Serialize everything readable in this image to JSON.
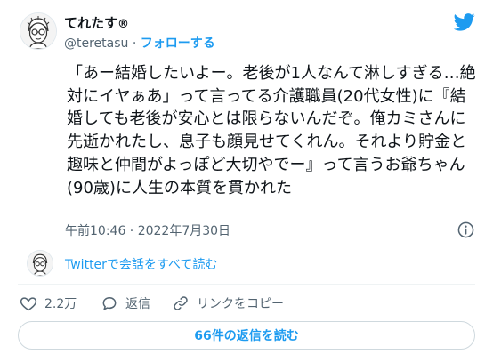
{
  "author": {
    "name": "てれたす",
    "badge": "®",
    "handle": "@teretasu",
    "separator": "·",
    "follow_label": "フォローする"
  },
  "tweet": {
    "text": "「あー結婚したいよー。老後が1人なんて淋しすぎる…絶対にイヤぁあ」って言ってる介護職員(20代女性)に『結婚しても老後が安心とは限らないんだぞ。俺カミさんに先逝かれたし、息子も顔見せてくれん。それより貯金と趣味と仲間がよっぽど大切やでー』って言うお爺ちゃん(90歳)に人生の本質を貫かれた",
    "time": "午前10:46 · 2022年7月30日"
  },
  "conversation": {
    "link_label": "Twitterで会話をすべて読む"
  },
  "actions": {
    "likes_count": "2.2万",
    "reply_label": "返信",
    "copy_link_label": "リンクをコピー"
  },
  "footer": {
    "replies_button": "66件の返信を読む"
  },
  "colors": {
    "accent": "#1d9bf0",
    "text": "#0f1419",
    "muted": "#536471",
    "like_icon": "#f91880"
  },
  "icons": {
    "brand": "twitter-bird-icon",
    "info": "info-icon",
    "like": "heart-icon",
    "reply": "speech-bubble-icon",
    "copy": "link-icon"
  }
}
